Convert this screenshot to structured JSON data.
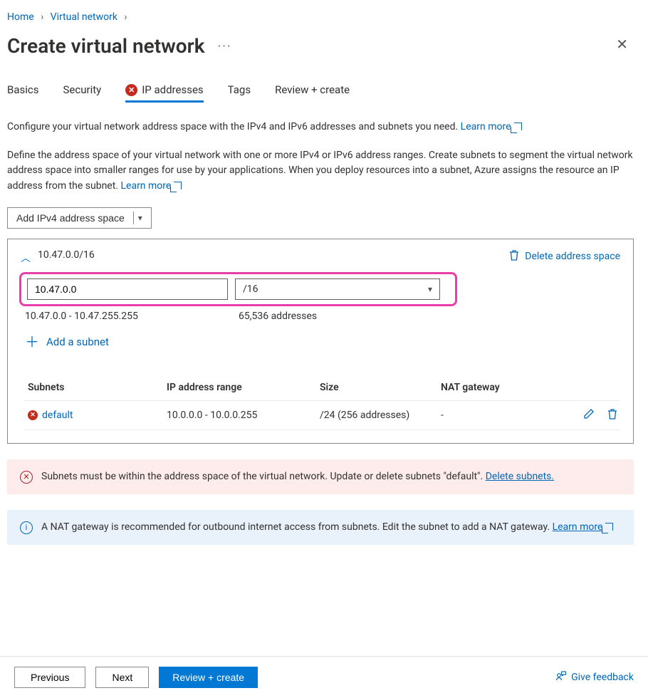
{
  "breadcrumb": {
    "home": "Home",
    "vnet": "Virtual network"
  },
  "title": "Create virtual network",
  "tabs": {
    "basics": "Basics",
    "security": "Security",
    "ip": "IP addresses",
    "tags": "Tags",
    "review": "Review + create"
  },
  "intro1": "Configure your virtual network address space with the IPv4 and IPv6 addresses and subnets you need.",
  "learn_more": "Learn more",
  "intro2": "Define the address space of your virtual network with one or more IPv4 or IPv6 address ranges. Create subnets to segment the virtual network address space into smaller ranges for use by your applications. When you deploy resources into a subnet, Azure assigns the resource an IP address from the subnet.",
  "add_ipv4": "Add IPv4 address space",
  "card": {
    "title": "10.47.0.0/16",
    "delete": "Delete address space",
    "ip_value": "10.47.0.0",
    "cidr_value": "/16",
    "range": "10.47.0.0 - 10.47.255.255",
    "count": "65,536 addresses",
    "add_subnet": "Add a subnet"
  },
  "table": {
    "headers": {
      "subnets": "Subnets",
      "range": "IP address range",
      "size": "Size",
      "nat": "NAT gateway"
    },
    "row": {
      "name": "default",
      "range": "10.0.0.0 - 10.0.0.255",
      "size": "/24 (256 addresses)",
      "nat": "-"
    }
  },
  "error_msg": "Subnets must be within the address space of the virtual network. Update or delete subnets \"default\".",
  "delete_subnets": "Delete subnets.",
  "info_msg": "A NAT gateway is recommended for outbound internet access from subnets. Edit the subnet to add a NAT gateway.",
  "footer": {
    "previous": "Previous",
    "next": "Next",
    "review": "Review + create",
    "feedback": "Give feedback"
  }
}
